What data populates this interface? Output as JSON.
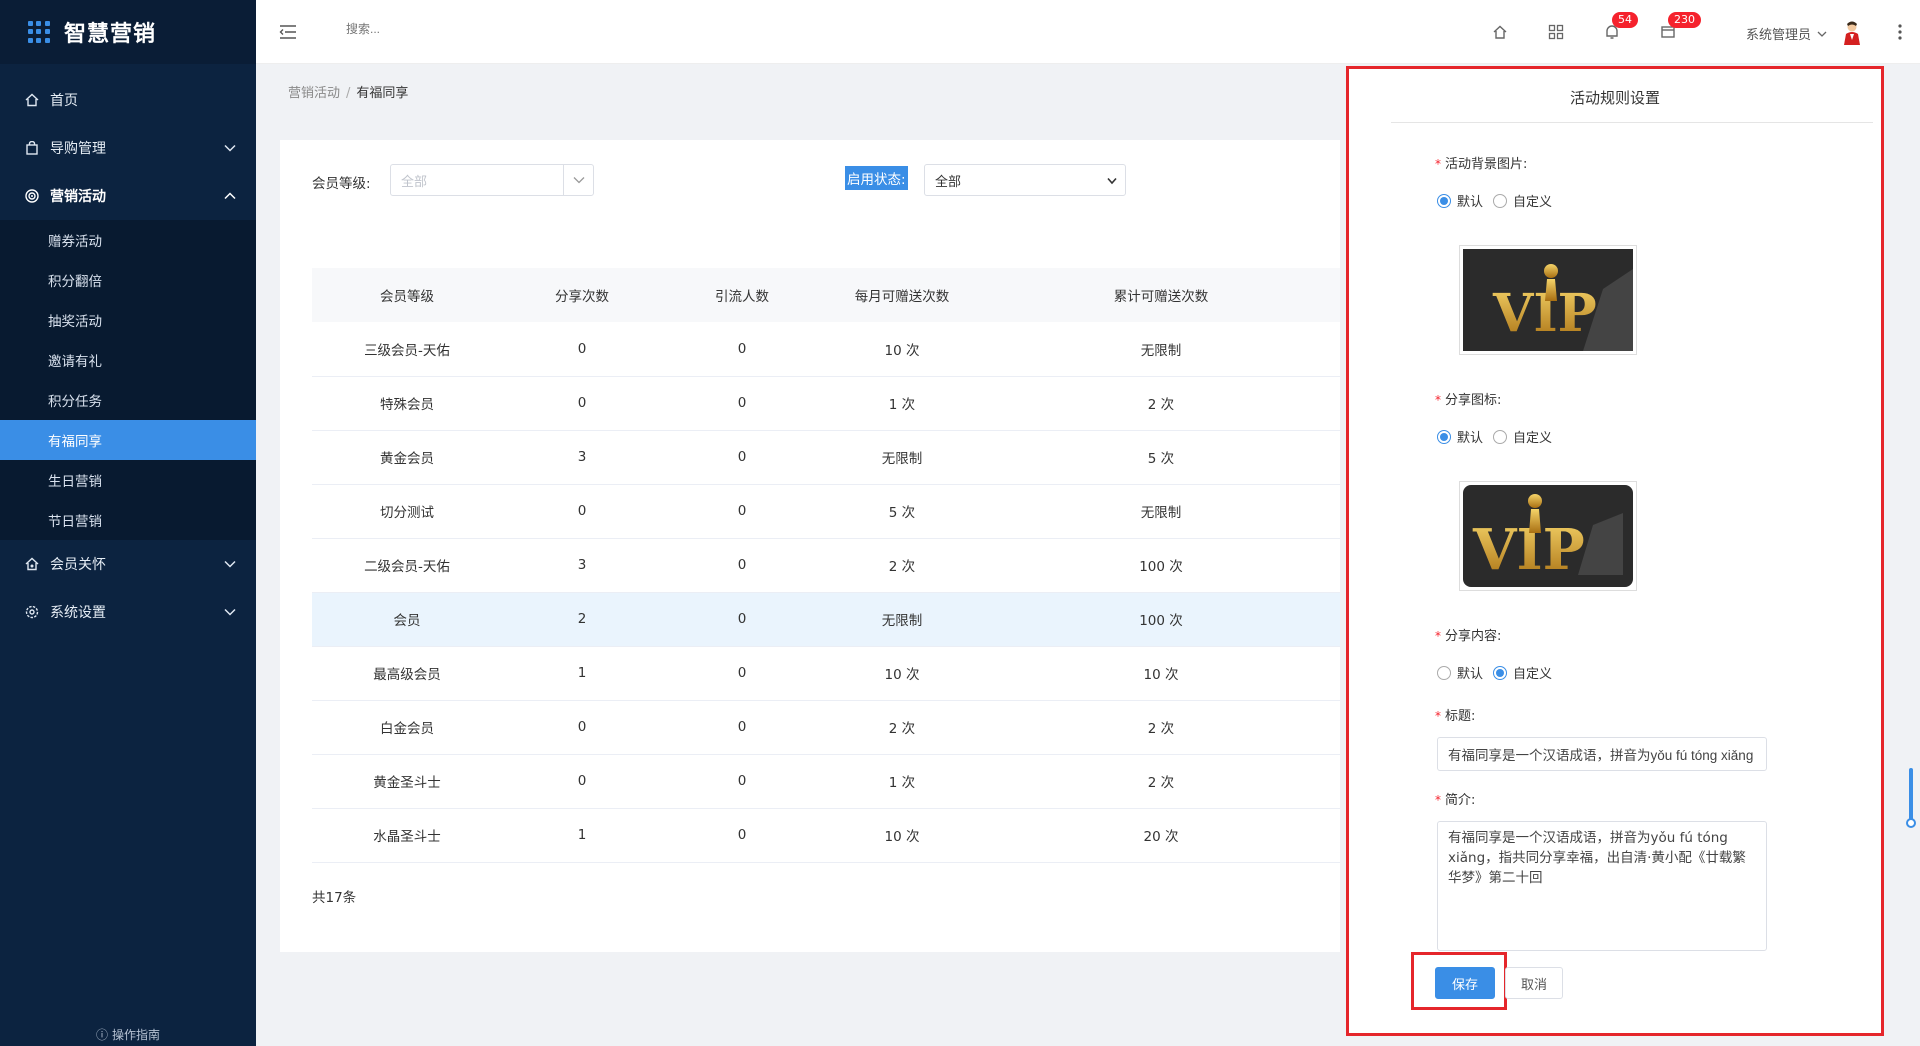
{
  "brand": {
    "name": "智慧营销"
  },
  "sidebar": {
    "items": [
      {
        "label": "首页",
        "icon": "home-icon"
      },
      {
        "label": "导购管理",
        "icon": "bag-icon"
      },
      {
        "label": "营销活动",
        "icon": "target-icon"
      },
      {
        "label": "会员关怀",
        "icon": "house-heart-icon"
      },
      {
        "label": "系统设置",
        "icon": "gear-icon"
      }
    ],
    "submenu": [
      {
        "label": "赠券活动"
      },
      {
        "label": "积分翻倍"
      },
      {
        "label": "抽奖活动"
      },
      {
        "label": "邀请有礼"
      },
      {
        "label": "积分任务"
      },
      {
        "label": "有福同享"
      },
      {
        "label": "生日营销"
      },
      {
        "label": "节日营销"
      }
    ],
    "guide_label": "操作指南"
  },
  "header": {
    "search_placeholder": "搜索...",
    "notifications_count": "54",
    "messages_count": "230",
    "user_name": "系统管理员"
  },
  "breadcrumb": {
    "parent": "营销活动",
    "current": "有福同享"
  },
  "filters": {
    "member_level_label": "会员等级:",
    "member_level_placeholder": "全部",
    "status_label": "启用状态:",
    "status_value": "全部"
  },
  "table": {
    "headers": [
      "会员等级",
      "分享次数",
      "引流人数",
      "每月可赠送次数",
      "累计可赠送次数"
    ],
    "rows": [
      [
        "三级会员-天佑",
        "0",
        "0",
        "10 次",
        "无限制"
      ],
      [
        "特殊会员",
        "0",
        "0",
        "1 次",
        "2 次"
      ],
      [
        "黄金会员",
        "3",
        "0",
        "无限制",
        "5 次"
      ],
      [
        "切分测试",
        "0",
        "0",
        "5 次",
        "无限制"
      ],
      [
        "二级会员-天佑",
        "3",
        "0",
        "2 次",
        "100 次"
      ],
      [
        "会员",
        "2",
        "0",
        "无限制",
        "100 次"
      ],
      [
        "最高级会员",
        "1",
        "0",
        "10 次",
        "10 次"
      ],
      [
        "白金会员",
        "0",
        "0",
        "2 次",
        "2 次"
      ],
      [
        "黄金圣斗士",
        "0",
        "0",
        "1 次",
        "2 次"
      ],
      [
        "水晶圣斗士",
        "1",
        "0",
        "10 次",
        "20 次"
      ]
    ],
    "total": "共17条"
  },
  "panel": {
    "title": "活动规则设置",
    "bg_image_label": "活动背景图片:",
    "share_icon_label": "分享图标:",
    "share_content_label": "分享内容:",
    "title_label": "标题:",
    "intro_label": "简介:",
    "option_default": "默认",
    "option_custom": "自定义",
    "title_value": "有福同享是一个汉语成语，拼音为yǒu fú tóng xiǎng",
    "intro_value": "有福同享是一个汉语成语，拼音为yǒu fú tóng xiǎng，指共同分享幸福，出自清·黄小配《廿载繁华梦》第二十回",
    "save_label": "保存",
    "cancel_label": "取消"
  },
  "colors": {
    "sidebar_bg": "#0c2340",
    "accent": "#3a8ee6",
    "highlight_frame": "#e5262b",
    "badge": "#f5222d"
  }
}
